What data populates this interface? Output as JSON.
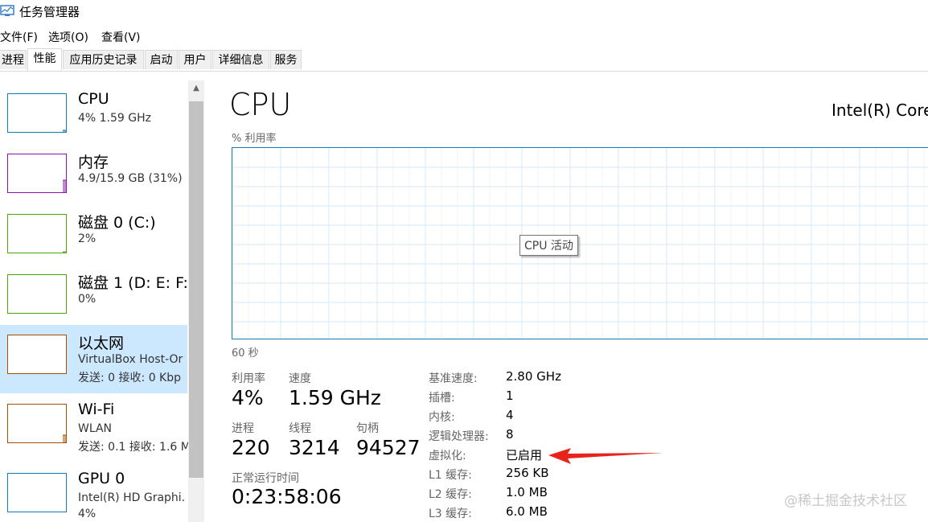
{
  "window": {
    "title": "任务管理器",
    "icon": "task-manager-icon"
  },
  "menu": [
    "文件(F)",
    "选项(O)",
    "查看(V)"
  ],
  "tabs": [
    "进程",
    "性能",
    "应用历史记录",
    "启动",
    "用户",
    "详细信息",
    "服务"
  ],
  "active_tab": "性能",
  "sidebar": {
    "items": [
      {
        "name": "CPU",
        "line1": "4% 1.59 GHz",
        "line2": "",
        "color": "#117dbb",
        "level": 0.04
      },
      {
        "name": "内存",
        "line1": "4.9/15.9 GB (31%)",
        "line2": "",
        "color": "#8b12ae",
        "level": 0.31
      },
      {
        "name": "磁盘 0 (C:)",
        "line1": "2%",
        "line2": "",
        "color": "#4da60c",
        "level": 0.02
      },
      {
        "name": "磁盘 1 (D: E: F:",
        "line1": "0%",
        "line2": "",
        "color": "#4da60c",
        "level": 0
      },
      {
        "name": "以太网",
        "line1": "VirtualBox Host-Or",
        "line2": "发送: 0 接收: 0 Kbp",
        "color": "#a74f01",
        "level": 0
      },
      {
        "name": "Wi-Fi",
        "line1": "WLAN",
        "line2": "发送: 0.1 接收: 1.6 M",
        "color": "#a74f01",
        "level": 0.2
      },
      {
        "name": "GPU 0",
        "line1": "Intel(R) HD Graphi.",
        "line2": "4%",
        "color": "#117dbb",
        "level": 0
      }
    ],
    "selected_index": 4
  },
  "main": {
    "title": "CPU",
    "model": "Intel(R) Core",
    "util_caption": "% 利用率",
    "graph_tooltip": "CPU 活动",
    "time_label": "60 秒",
    "stats": {
      "util_label": "利用率",
      "util_value": "4%",
      "speed_label": "速度",
      "speed_value": "1.59 GHz",
      "proc_label": "进程",
      "proc_value": "220",
      "thread_label": "线程",
      "thread_value": "3214",
      "handle_label": "句柄",
      "handle_value": "94527",
      "uptime_label": "正常运行时间",
      "uptime_value": "0:23:58:06"
    },
    "specs": [
      {
        "label": "基准速度:",
        "value": "2.80 GHz"
      },
      {
        "label": "插槽:",
        "value": "1"
      },
      {
        "label": "内核:",
        "value": "4"
      },
      {
        "label": "逻辑处理器:",
        "value": "8"
      },
      {
        "label": "虚拟化:",
        "value": "已启用"
      },
      {
        "label": "L1 缓存:",
        "value": "256 KB"
      },
      {
        "label": "L2 缓存:",
        "value": "1.0 MB"
      },
      {
        "label": "L3 缓存:",
        "value": "6.0 MB"
      }
    ]
  },
  "annotation": {
    "arrow_color": "#e8231c"
  },
  "watermark": "@稀土掘金技术社区"
}
